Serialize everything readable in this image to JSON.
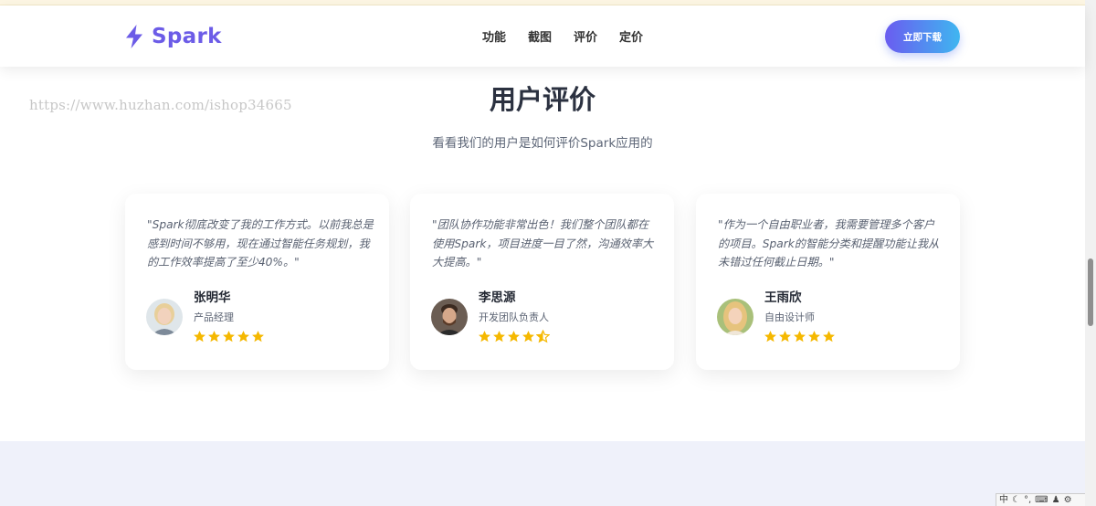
{
  "brand": {
    "name": "Spark",
    "color": "#6c5ce7"
  },
  "nav": {
    "links": [
      "功能",
      "截图",
      "评价",
      "定价"
    ],
    "cta_label": "立即下载"
  },
  "watermark": "https://www.huzhan.com/ishop34665",
  "section": {
    "title": "用户评价",
    "subtitle": "看看我们的用户是如何评价Spark应用的"
  },
  "testimonials": [
    {
      "quote": "\"Spark彻底改变了我的工作方式。以前我总是感到时间不够用，现在通过智能任务规划，我的工作效率提高了至少40%。\"",
      "name": "张明华",
      "role": "产品经理",
      "rating": 5,
      "avatar_icon": "woman-short-blonde-avatar"
    },
    {
      "quote": "\"团队协作功能非常出色！我们整个团队都在使用Spark，项目进度一目了然，沟通效率大大提高。\"",
      "name": "李思源",
      "role": "开发团队负责人",
      "rating": 4.5,
      "avatar_icon": "man-beard-avatar"
    },
    {
      "quote": "\"作为一个自由职业者，我需要管理多个客户的项目。Spark的智能分类和提醒功能让我从未错过任何截止日期。\"",
      "name": "王雨欣",
      "role": "自由设计师",
      "rating": 5,
      "avatar_icon": "woman-long-blonde-avatar"
    }
  ],
  "colors": {
    "star": "#f5b800",
    "cta_gradient_start": "#6a5cf0",
    "cta_gradient_end": "#3fb6f0",
    "bottom_band": "#eff1fa"
  },
  "tray": {
    "ime_label": "中"
  }
}
